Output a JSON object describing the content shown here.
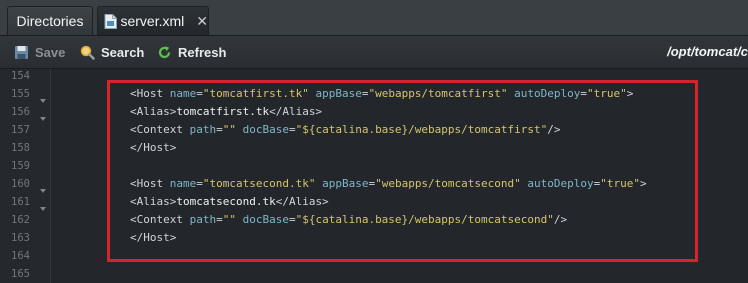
{
  "tabs": {
    "directories": "Directories",
    "server": "server.xml"
  },
  "toolbar": {
    "save": "Save",
    "search": "Search",
    "refresh": "Refresh",
    "path": "/opt/tomcat/c"
  },
  "editor": {
    "line_numbers": [
      "154",
      "155",
      "156",
      "157",
      "158",
      "159",
      "160",
      "161",
      "162",
      "163",
      "164",
      "165"
    ],
    "lines": {
      "l155": {
        "open": "<Host ",
        "a1": "name",
        "eq1": "=",
        "v1": "\"tomcatfirst.tk\"",
        "a2": " appBase",
        "eq2": "=",
        "v2": "\"webapps/tomcatfirst\"",
        "a3": " autoDeploy",
        "eq3": "=",
        "v3": "\"true\"",
        "close": ">"
      },
      "l156": {
        "open": "<Alias>",
        "text": "tomcatfirst.tk",
        "close": "</Alias>"
      },
      "l157": {
        "open": "<Context ",
        "a1": "path",
        "eq1": "=",
        "v1": "\"\"",
        "a2": " docBase",
        "eq2": "=",
        "v2": "\"${catalina.base}/webapps/tomcatfirst\"",
        "close": "/>"
      },
      "l158": {
        "open": "</Host>"
      },
      "l160": {
        "open": "<Host ",
        "a1": "name",
        "eq1": "=",
        "v1": "\"tomcatsecond.tk\"",
        "a2": " appBase",
        "eq2": "=",
        "v2": "\"webapps/tomcatsecond\"",
        "a3": " autoDeploy",
        "eq3": "=",
        "v3": "\"true\"",
        "close": ">"
      },
      "l161": {
        "open": "<Alias>",
        "text": "tomcatsecond.tk",
        "close": "</Alias>"
      },
      "l162": {
        "open": "<Context ",
        "a1": "path",
        "eq1": "=",
        "v1": "\"\"",
        "a2": " docBase",
        "eq2": "=",
        "v2": "\"${catalina.base}/webapps/tomcatsecond\"",
        "close": "/>"
      },
      "l163": {
        "open": "</Host>"
      }
    }
  },
  "colors": {
    "highlight_border": "#d6242a",
    "tag": "#d0d4d8",
    "attribute": "#7fb6c8",
    "value": "#d6c46a"
  },
  "icons": [
    "file-xml-icon",
    "close-icon",
    "save-icon",
    "search-icon",
    "refresh-icon",
    "fold-arrow-icon"
  ]
}
